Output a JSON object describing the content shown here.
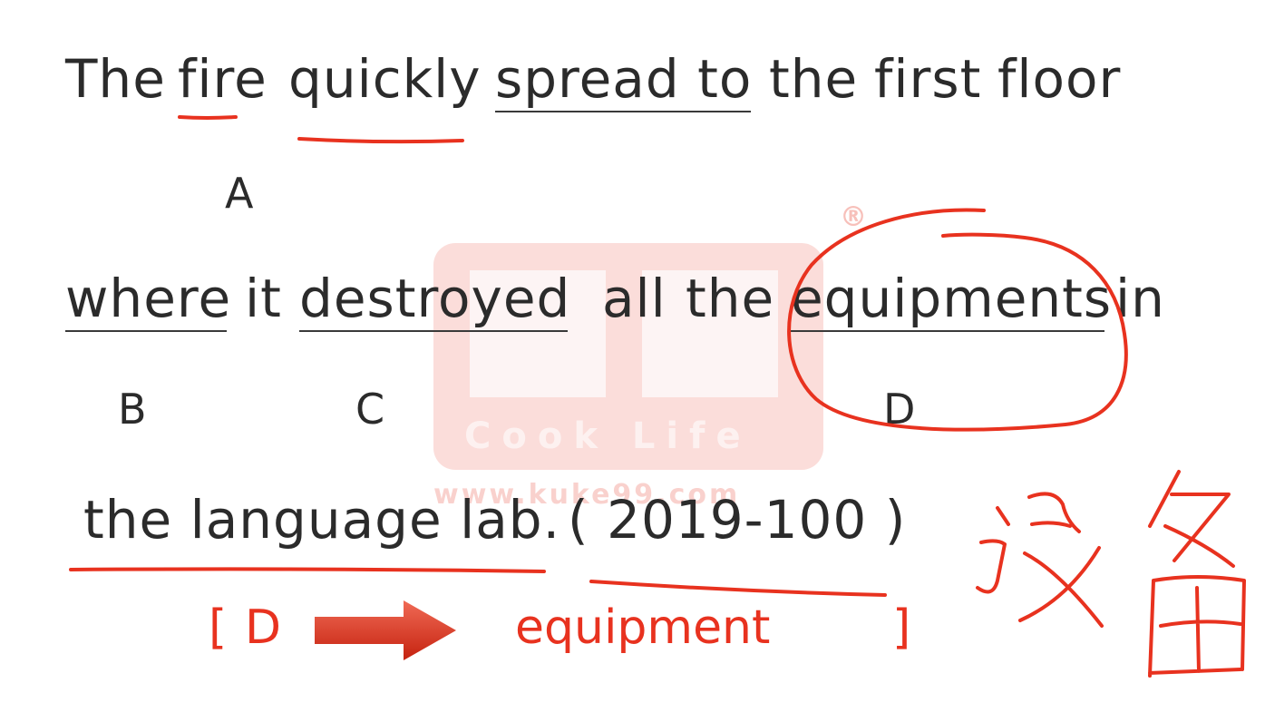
{
  "sentence": {
    "line1": [
      "The",
      "fire",
      "quickly",
      "spread to",
      "the",
      "first",
      "floor"
    ],
    "line2": [
      "where",
      "it",
      "destroyed",
      "all",
      "the",
      "equipments",
      "in"
    ],
    "line3": [
      "the language lab.",
      "( 2019-100 )"
    ]
  },
  "options": {
    "a": "A",
    "b": "B",
    "c": "C",
    "d": "D"
  },
  "answer": {
    "open": "[",
    "letter": "D",
    "correction": "equipment",
    "close": "]"
  },
  "watermark": {
    "brand": "Cook Life",
    "url": "www.kuke99.com",
    "mark": "®"
  },
  "handwriting": {
    "chinese_note": "设备"
  },
  "colors": {
    "ink_red": "#e8321f",
    "text": "#2b2b2b",
    "underline": "#3a3a3a"
  },
  "icons": {
    "arrow": "right-arrow-icon"
  }
}
